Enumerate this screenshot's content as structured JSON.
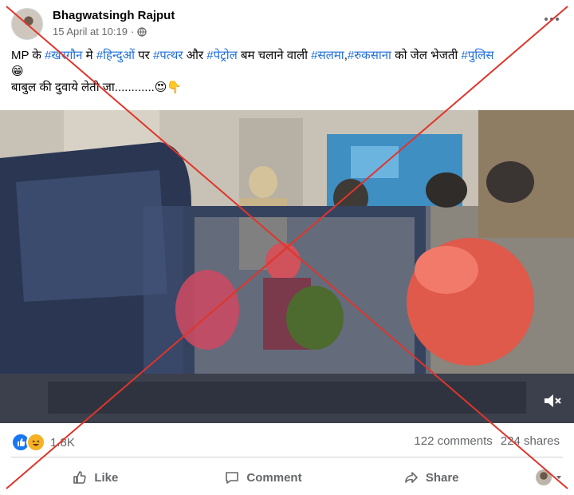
{
  "post": {
    "author": "Bhagwatsingh Rajput",
    "timestamp": "15 April at 10:19",
    "separator": "·",
    "audience_icon": "globe-icon",
    "text_segments": [
      {
        "text": "MP के ",
        "tag": false
      },
      {
        "text": "#खरगौन",
        "tag": true
      },
      {
        "text": " मे ",
        "tag": false
      },
      {
        "text": "#हिन्दुओं",
        "tag": true
      },
      {
        "text": " पर ",
        "tag": false
      },
      {
        "text": "#पत्थर",
        "tag": true
      },
      {
        "text": " और ",
        "tag": false
      },
      {
        "text": "#पेट्रोल",
        "tag": true
      },
      {
        "text": " बम चलाने वाली ",
        "tag": false
      },
      {
        "text": "#सलमा",
        "tag": true
      },
      {
        "text": ",",
        "tag": false
      },
      {
        "text": "#रुकसाना",
        "tag": true
      },
      {
        "text": " को जेल भेजती ",
        "tag": false
      },
      {
        "text": "#पुलिस",
        "tag": true
      }
    ],
    "emoji_line": "😁",
    "text_line2": "बाबुल की दुवाये लेती जा............😍👇"
  },
  "stats": {
    "reaction_count": "1.8K",
    "comments": "122 comments",
    "shares": "224 shares"
  },
  "actions": {
    "like": "Like",
    "comment": "Comment",
    "share": "Share"
  },
  "colors": {
    "hashtag": "#216fdb",
    "cross": "#e0352b",
    "muted": "#65676b"
  }
}
